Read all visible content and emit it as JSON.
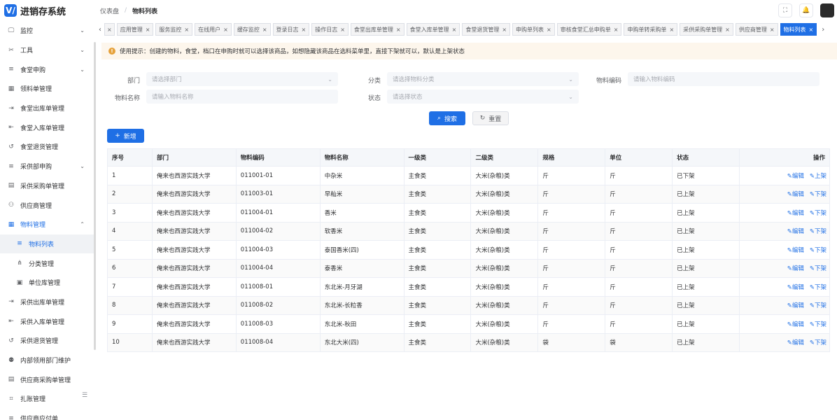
{
  "app": {
    "logo_mark": "V/",
    "title": "进销存系统"
  },
  "breadcrumb": [
    "仪表盘",
    "/",
    "物料列表"
  ],
  "header_icons": [
    "fullscreen-icon",
    "bell-icon"
  ],
  "sidebar": {
    "items": [
      {
        "label": "监控",
        "icon": "monitor-icon",
        "arrow": "⌄",
        "type": "parent"
      },
      {
        "label": "工具",
        "icon": "tool-icon",
        "arrow": "⌄",
        "type": "parent"
      },
      {
        "label": "食堂申购",
        "icon": "list-icon",
        "arrow": "⌄",
        "type": "parent"
      },
      {
        "label": "领料单管理",
        "icon": "grid-icon",
        "type": "item"
      },
      {
        "label": "食堂出库单管理",
        "icon": "export-icon",
        "type": "item"
      },
      {
        "label": "食堂入库单管理",
        "icon": "import-icon",
        "type": "item"
      },
      {
        "label": "食堂退货管理",
        "icon": "undo-icon",
        "type": "item"
      },
      {
        "label": "采供部申购",
        "icon": "list-icon",
        "arrow": "⌄",
        "type": "parent"
      },
      {
        "label": "采供采购单管理",
        "icon": "card-icon",
        "type": "item"
      },
      {
        "label": "供应商管理",
        "icon": "user-icon",
        "type": "item"
      },
      {
        "label": "物料管理",
        "icon": "grid-icon",
        "arrow": "⌃",
        "type": "open"
      },
      {
        "label": "物料列表",
        "icon": "list-icon",
        "type": "active"
      },
      {
        "label": "分类管理",
        "icon": "tree-icon",
        "type": "sub"
      },
      {
        "label": "单位库管理",
        "icon": "save-icon",
        "type": "sub"
      },
      {
        "label": "采供出库单管理",
        "icon": "export-icon",
        "type": "item"
      },
      {
        "label": "采供入库单管理",
        "icon": "import-icon",
        "type": "item"
      },
      {
        "label": "采供退货管理",
        "icon": "undo-icon",
        "type": "item"
      },
      {
        "label": "内部领用部门维护",
        "icon": "users-icon",
        "type": "item"
      },
      {
        "label": "供应商采购单管理",
        "icon": "card-icon",
        "type": "item"
      },
      {
        "label": "扎账管理",
        "icon": "scan-icon",
        "type": "item"
      },
      {
        "label": "供应商应付单",
        "icon": "list-icon",
        "type": "item"
      }
    ]
  },
  "tabs": [
    "应用管理",
    "服务监控",
    "在线用户",
    "缓存监控",
    "登录日志",
    "操作日志",
    "食堂出库单管理",
    "食堂入库单管理",
    "食堂退货管理",
    "申购单列表",
    "审核食堂汇总申购单",
    "申购单转采购单",
    "采供采购单管理",
    "供应商管理",
    "物料列表"
  ],
  "tip": "使用提示：创建的物料，食堂，档口在申购时就可以选择该商品，如想隐藏该商品在选料菜单里，直接下架就可以，默认是上架状态",
  "form": {
    "dept_label": "部门",
    "dept_placeholder": "请选择部门",
    "cat_label": "分类",
    "cat_placeholder": "请选择物料分类",
    "code_label": "物料编码",
    "code_placeholder": "请输入物料编码",
    "name_label": "物料名称",
    "name_placeholder": "请输入物料名称",
    "status_label": "状态",
    "status_placeholder": "请选择状态"
  },
  "buttons": {
    "search": "搜索",
    "reset": "重置",
    "add": "新增"
  },
  "table": {
    "headers": [
      "序号",
      "部门",
      "物料编码",
      "物料名称",
      "一级类",
      "二级类",
      "规格",
      "单位",
      "状态",
      "操作"
    ],
    "rows": [
      {
        "no": "1",
        "dept": "俺来也西游实践大学",
        "code": "011001-01",
        "name": "中杂米",
        "c1": "主食类",
        "c2": "大米(杂粮)类",
        "spec": "斤",
        "unit": "斤",
        "status": "已下架",
        "edit": "编辑",
        "toggle": "上架",
        "off": true
      },
      {
        "no": "2",
        "dept": "俺来也西游实践大学",
        "code": "011003-01",
        "name": "早籼米",
        "c1": "主食类",
        "c2": "大米(杂粮)类",
        "spec": "斤",
        "unit": "斤",
        "status": "已上架",
        "edit": "编辑",
        "toggle": "下架",
        "off": false
      },
      {
        "no": "3",
        "dept": "俺来也西游实践大学",
        "code": "011004-01",
        "name": "香米",
        "c1": "主食类",
        "c2": "大米(杂粮)类",
        "spec": "斤",
        "unit": "斤",
        "status": "已上架",
        "edit": "编辑",
        "toggle": "下架",
        "off": false
      },
      {
        "no": "4",
        "dept": "俺来也西游实践大学",
        "code": "011004-02",
        "name": "软香米",
        "c1": "主食类",
        "c2": "大米(杂粮)类",
        "spec": "斤",
        "unit": "斤",
        "status": "已上架",
        "edit": "编辑",
        "toggle": "下架",
        "off": false
      },
      {
        "no": "5",
        "dept": "俺来也西游实践大学",
        "code": "011004-03",
        "name": "泰国香米(四)",
        "c1": "主食类",
        "c2": "大米(杂粮)类",
        "spec": "斤",
        "unit": "斤",
        "status": "已上架",
        "edit": "编辑",
        "toggle": "下架",
        "off": false
      },
      {
        "no": "6",
        "dept": "俺来也西游实践大学",
        "code": "011004-04",
        "name": "泰香米",
        "c1": "主食类",
        "c2": "大米(杂粮)类",
        "spec": "斤",
        "unit": "斤",
        "status": "已上架",
        "edit": "编辑",
        "toggle": "下架",
        "off": false
      },
      {
        "no": "7",
        "dept": "俺来也西游实践大学",
        "code": "011008-01",
        "name": "东北米-月牙湖",
        "c1": "主食类",
        "c2": "大米(杂粮)类",
        "spec": "斤",
        "unit": "斤",
        "status": "已上架",
        "edit": "编辑",
        "toggle": "下架",
        "off": false
      },
      {
        "no": "8",
        "dept": "俺来也西游实践大学",
        "code": "011008-02",
        "name": "东北米-长粒香",
        "c1": "主食类",
        "c2": "大米(杂粮)类",
        "spec": "斤",
        "unit": "斤",
        "status": "已上架",
        "edit": "编辑",
        "toggle": "下架",
        "off": false
      },
      {
        "no": "9",
        "dept": "俺来也西游实践大学",
        "code": "011008-03",
        "name": "东北米-秋田",
        "c1": "主食类",
        "c2": "大米(杂粮)类",
        "spec": "斤",
        "unit": "斤",
        "status": "已上架",
        "edit": "编辑",
        "toggle": "下架",
        "off": false
      },
      {
        "no": "10",
        "dept": "俺来也西游实践大学",
        "code": "011008-04",
        "name": "东北大米(四)",
        "c1": "主食类",
        "c2": "大米(杂粮)类",
        "spec": "袋",
        "unit": "袋",
        "status": "已上架",
        "edit": "编辑",
        "toggle": "下架",
        "off": false
      }
    ]
  },
  "colors": {
    "primary": "#1f6fe5",
    "danger": "#f56c6c",
    "warning_bg": "#fdf6ec",
    "warning_icon": "#e6a23c"
  }
}
